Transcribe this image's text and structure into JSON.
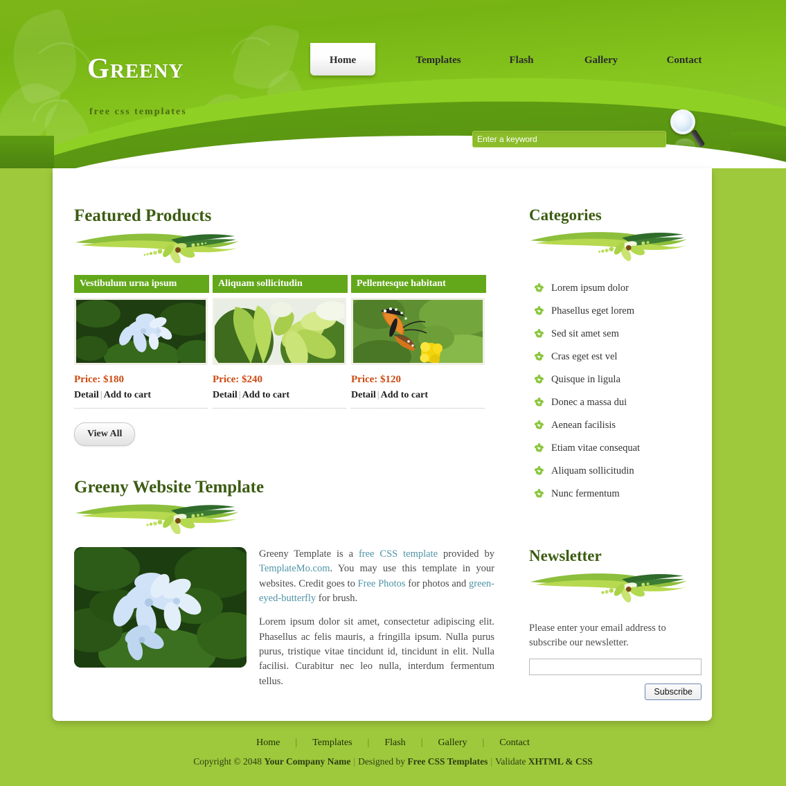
{
  "site": {
    "logo": "Greeny",
    "tagline": "free css templates"
  },
  "nav": {
    "items": [
      {
        "label": "Home",
        "active": true
      },
      {
        "label": "Templates",
        "active": false
      },
      {
        "label": "Flash",
        "active": false
      },
      {
        "label": "Gallery",
        "active": false
      },
      {
        "label": "Contact",
        "active": false
      }
    ]
  },
  "search": {
    "placeholder": "Enter a keyword",
    "value": "",
    "icon": "magnifier-icon"
  },
  "featured": {
    "title": "Featured Products",
    "view_all_label": "View All",
    "products": [
      {
        "title": "Vestibulum urna ipsum",
        "price": "Price: $180",
        "detail_label": "Detail",
        "separator": "|",
        "cart_label": "Add to cart",
        "image_alt": "blue plumbago flowers"
      },
      {
        "title": "Aliquam sollicitudin",
        "price": "Price: $240",
        "detail_label": "Detail",
        "separator": "|",
        "cart_label": "Add to cart",
        "image_alt": "green plant buds"
      },
      {
        "title": "Pellentesque habitant",
        "price": "Price: $120",
        "detail_label": "Detail",
        "separator": "|",
        "cart_label": "Add to cart",
        "image_alt": "monarch butterfly on yellow flower"
      }
    ]
  },
  "article": {
    "title": "Greeny Website Template",
    "image_alt": "blue plumbago flowers closeup",
    "paragraph1": {
      "t1": "Greeny Template is a ",
      "link1": "free CSS template",
      "t2": " provided by ",
      "link2": "TemplateMo.com",
      "t3": ". You may use this template in your websites. Credit goes to ",
      "link3": "Free Photos",
      "t4": " for photos and ",
      "link4": "green-eyed-butterfly",
      "t5": " for brush."
    },
    "paragraph2": "Lorem ipsum dolor sit amet, consectetur adipiscing elit. Phasellus ac felis mauris, a fringilla ipsum. Nulla purus purus, tristique vitae tincidunt id, tincidunt in elit. Nulla facilisi. Curabitur nec leo nulla, interdum fermentum tellus."
  },
  "categories": {
    "title": "Categories",
    "items": [
      "Lorem ipsum dolor",
      "Phasellus eget lorem",
      "Sed sit amet sem",
      "Cras eget est vel",
      "Quisque in ligula",
      "Donec a massa dui",
      "Aenean facilisis",
      "Etiam vitae consequat",
      "Aliquam sollicitudin",
      "Nunc fermentum"
    ]
  },
  "newsletter": {
    "title": "Newsletter",
    "text": "Please enter your email address to subscribe our newsletter.",
    "input_value": "",
    "button_label": "Subscribe"
  },
  "footer": {
    "nav": [
      "Home",
      "Templates",
      "Flash",
      "Gallery",
      "Contact"
    ],
    "separator": "|",
    "copyright": {
      "c1": "Copyright © 2048 ",
      "company": "Your Company Name",
      "c2": "Designed by ",
      "designer": "Free CSS Templates",
      "c3": "Validate ",
      "validate": "XHTML & CSS"
    }
  },
  "colors": {
    "page_bg": "#9fc93c",
    "header_green": "#7db518",
    "dark_green": "#5d9c12",
    "heading_green": "#3c5c12",
    "product_bar": "#63a81a",
    "price_orange": "#cc4a12",
    "link_teal": "#4f93a6"
  }
}
